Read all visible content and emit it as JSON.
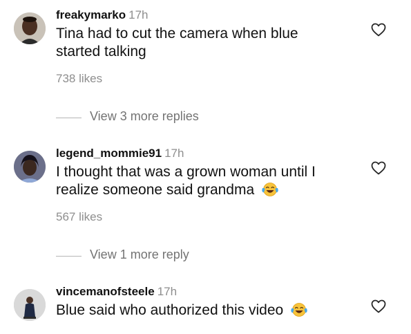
{
  "comments": [
    {
      "username": "freakymarko",
      "time": "17h",
      "text": "Tina had to cut the camera when blue started talking",
      "likes": "738 likes",
      "replies": "View 3 more replies",
      "avatar_icon": "profile-photo"
    },
    {
      "username": "legend_mommie91",
      "time": "17h",
      "text": "I thought that was a grown woman until I realize someone said grandma",
      "emoji": "face-with-tears-of-joy",
      "likes": "567 likes",
      "replies": "View 1 more reply",
      "avatar_icon": "profile-photo"
    },
    {
      "username": "vincemanofsteele",
      "time": "17h",
      "text": "Blue said who authorized this video",
      "emoji": "face-with-tears-of-joy",
      "avatar_icon": "profile-photo"
    }
  ],
  "icons": {
    "like": "heart-outline-icon"
  },
  "colors": {
    "secondary_text": "#8e8e8e",
    "primary_text": "#111111"
  }
}
